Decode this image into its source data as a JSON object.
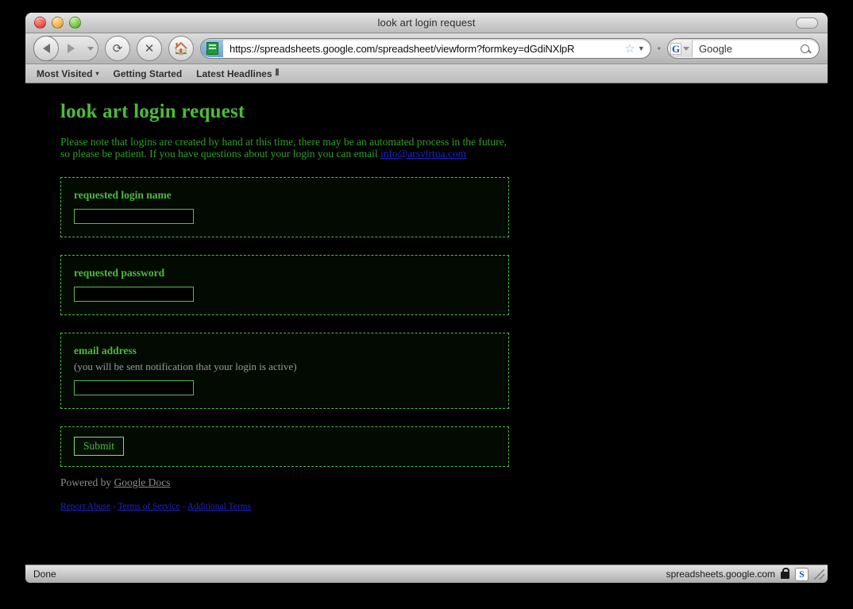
{
  "window": {
    "title": "look art login request",
    "traffic_lights": [
      "close",
      "minimize",
      "zoom"
    ],
    "toolbar_toggle": "toolbar-toggle"
  },
  "navbar": {
    "back_label": "Back",
    "forward_label": "Forward",
    "history_dropdown_label": "Recent history",
    "reload_label": "Reload",
    "stop_label": "Stop",
    "home_label": "Home",
    "url": "https://spreadsheets.google.com/spreadsheet/viewform?formkey=dGdiNXlpR",
    "bookmark_star": "☆",
    "url_dropdown": "▼",
    "search_engine": "G",
    "search_value": "Google",
    "search_placeholder": "Google"
  },
  "bookmarks": [
    {
      "label": "Most Visited",
      "caret": "▾",
      "rss": ""
    },
    {
      "label": "Getting Started",
      "caret": "",
      "rss": ""
    },
    {
      "label": "Latest Headlines",
      "caret": "",
      "rss": "⦀"
    }
  ],
  "page": {
    "title": "look art login request",
    "description_part1": "Please note that logins are created by hand at this time, there may be an automated process in the future, so please be patient.  If you have questions about your login you can email ",
    "description_email": "info@arsvirtua.com",
    "fields": [
      {
        "label": "requested login name",
        "help": "",
        "value": "",
        "placeholder": "",
        "type": "text"
      },
      {
        "label": "requested password",
        "help": "",
        "value": "",
        "placeholder": "",
        "type": "text"
      },
      {
        "label": "email address",
        "help": "(you will be sent notification that your login is active)",
        "value": "",
        "placeholder": "",
        "type": "text"
      }
    ],
    "submit_label": "Submit",
    "powered_prefix": "Powered by ",
    "powered_link": "Google Docs",
    "footer_links": [
      {
        "label": "Report Abuse"
      },
      {
        "label": "Terms of Service"
      },
      {
        "label": "Additional Terms"
      }
    ],
    "footer_separator": " - "
  },
  "statusbar": {
    "status": "Done",
    "host": "spreadsheets.google.com",
    "secure_badge": "S"
  },
  "colors": {
    "accent_green": "#4cbb3c",
    "body_background": "#000000",
    "box_background": "#020a02",
    "link_blue": "#2323c8",
    "help_gray": "#9a9a9a"
  }
}
